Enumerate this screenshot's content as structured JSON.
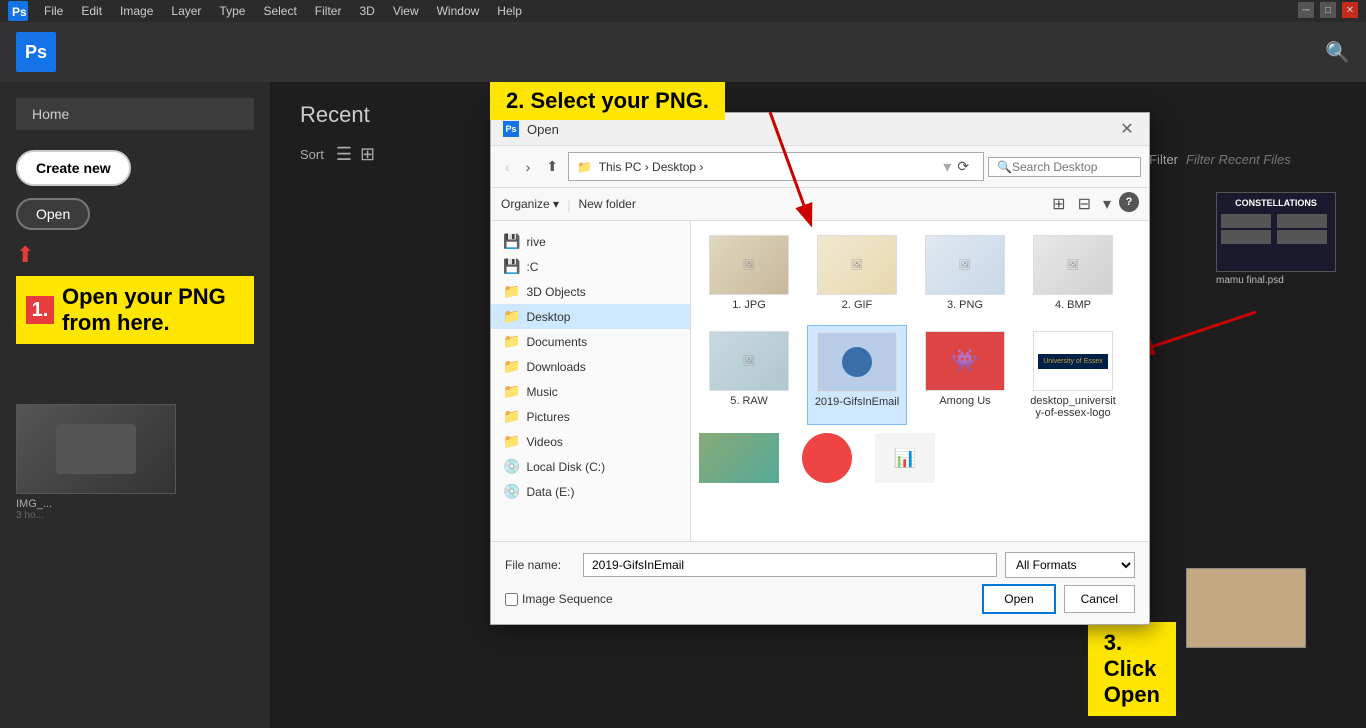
{
  "menu": {
    "items": [
      "File",
      "Edit",
      "Image",
      "Layer",
      "Type",
      "Select",
      "Filter",
      "3D",
      "View",
      "Window",
      "Help"
    ]
  },
  "header": {
    "logo_text": "Ps",
    "search_placeholder": "🔍"
  },
  "sidebar": {
    "home_label": "Home",
    "create_new_label": "Create new",
    "open_label": "Open"
  },
  "content": {
    "recent_title": "Recent",
    "sort_label": "Sort",
    "filter_label": "Filter",
    "filter_placeholder": "Filter Recent Files"
  },
  "dialog": {
    "title": "Open",
    "ps_logo": "Ps",
    "breadcrumb": "This PC  >  Desktop  >",
    "search_placeholder": "Search Desktop",
    "organize_label": "Organize ▾",
    "new_folder_label": "New folder",
    "folders": [
      {
        "name": "rive",
        "type": "drive"
      },
      {
        "name": ":C",
        "type": "drive"
      },
      {
        "name": "3D Objects",
        "type": "folder"
      },
      {
        "name": "Desktop",
        "type": "folder",
        "active": true
      },
      {
        "name": "Documents",
        "type": "folder"
      },
      {
        "name": "Downloads",
        "type": "folder"
      },
      {
        "name": "Music",
        "type": "folder"
      },
      {
        "name": "Pictures",
        "type": "folder"
      },
      {
        "name": "Videos",
        "type": "folder"
      },
      {
        "name": "Local Disk (C:)",
        "type": "drive"
      },
      {
        "name": "Data (E:)",
        "type": "drive"
      }
    ],
    "files": [
      {
        "name": "1. JPG",
        "type": "jpg"
      },
      {
        "name": "2. GIF",
        "type": "gif"
      },
      {
        "name": "3. PNG",
        "type": "png"
      },
      {
        "name": "4. BMP",
        "type": "bmp"
      },
      {
        "name": "5. RAW",
        "type": "raw"
      },
      {
        "name": "2019-GifsInEmail",
        "type": "gifs",
        "selected": true
      },
      {
        "name": "Among Us",
        "type": "among"
      },
      {
        "name": "desktop_university-of-essex-logo",
        "type": "essex"
      }
    ],
    "filename_label": "File name:",
    "filename_value": "2019-GifsInEmail",
    "format_label": "All Formats",
    "image_sequence_label": "Image Sequence",
    "open_btn_label": "Open",
    "cancel_btn_label": "Cancel"
  },
  "instructions": {
    "step1_num": "1.",
    "step1_text": "Open your PNG from here.",
    "step2_text": "2. Select your PNG.",
    "step3_text": "3. Click Open"
  },
  "right_panel": {
    "file1_label": "mamu final.psd",
    "file1_placeholder": "constellations"
  },
  "window_controls": {
    "minimize": "─",
    "maximize": "□",
    "close": "✕"
  }
}
